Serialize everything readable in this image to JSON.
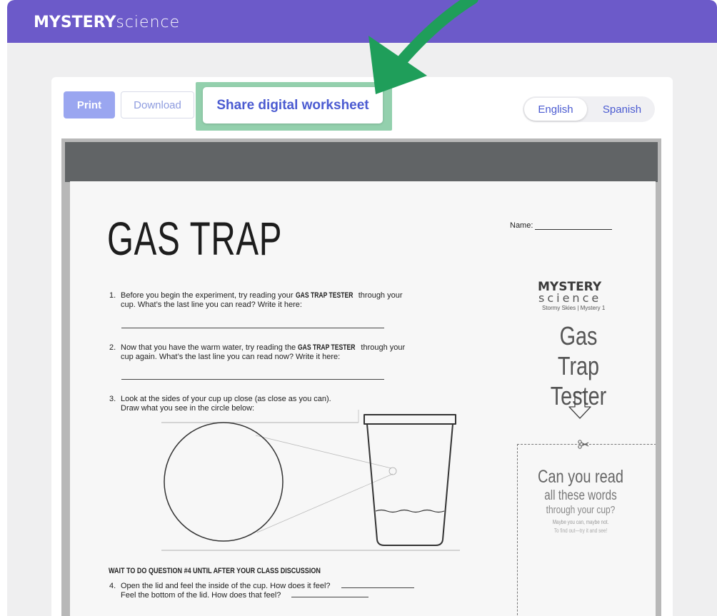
{
  "brand": {
    "bold": "MYSTERY",
    "light": "science"
  },
  "toolbar": {
    "print_label": "Print",
    "download_label": "Download",
    "share_label": "Share digital worksheet"
  },
  "language": {
    "options": [
      "English",
      "Spanish"
    ],
    "selected": "English"
  },
  "worksheet": {
    "title": "GAS TRAP",
    "name_label": "Name:",
    "q1": {
      "num": "1.",
      "line1_pre": "Before you begin the experiment, try reading your ",
      "line1_em": "GAS TRAP TESTER",
      "line1_post": " through your",
      "line2": "cup. What’s the last line you can read? Write it here:"
    },
    "q2": {
      "num": "2.",
      "line1_pre": "Now that you have the warm water, try reading the ",
      "line1_em": "GAS TRAP TESTER",
      "line1_post": " through your",
      "line2": "cup again. What’s the last line you can read now? Write it here:"
    },
    "q3": {
      "num": "3.",
      "line1": "Look at the sides of your cup up close (as close as you can).",
      "line2": "Draw what you see in the circle below:"
    },
    "warning": "WAIT TO DO QUESTION #4 UNTIL AFTER YOUR CLASS DISCUSSION",
    "q4": {
      "num": "4.",
      "line1": "Open the lid and feel the inside of the cup. How does it feel?",
      "line2": "Feel the bottom of the lid. How does that feel?"
    },
    "side": {
      "brand_bold": "MYSTERY",
      "brand_light": "science",
      "subtitle": "Stormy Skies | Mystery 1",
      "title_line1": "Gas Trap",
      "title_line2": "Tester",
      "card_line1": "Can you read",
      "card_line2": "all these words",
      "card_line3": "through your cup?",
      "card_line4": "Maybe you can, maybe not.",
      "card_line5": "To find out—try it and see!"
    }
  },
  "colors": {
    "header": "#6c5ac9",
    "accent": "#4b5bd1",
    "highlight": "#93d0ad",
    "arrow": "#1f9e5a"
  }
}
